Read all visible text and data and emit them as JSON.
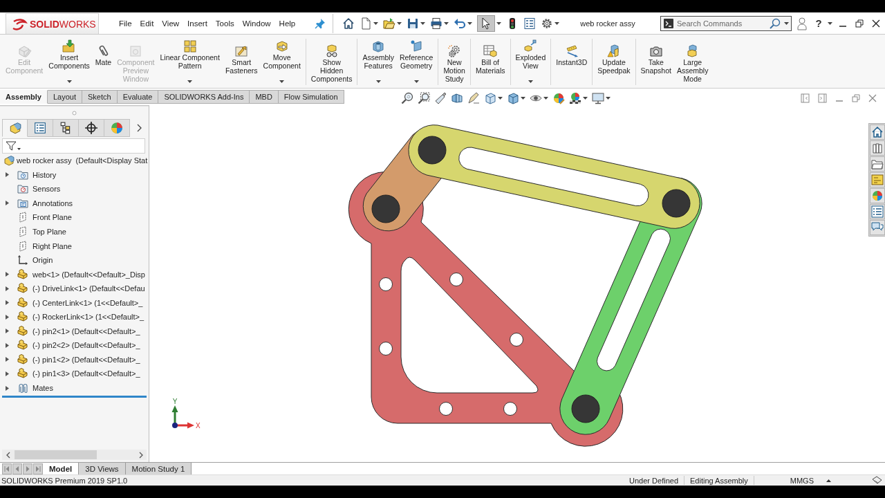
{
  "logo": {
    "text": "**SOLID**WORKS"
  },
  "menu": [
    "File",
    "Edit",
    "View",
    "Insert",
    "Tools",
    "Window",
    "Help"
  ],
  "document_title": "web rocker assy",
  "search": {
    "placeholder": "Search Commands"
  },
  "help": {
    "label": "?"
  },
  "ribbon": {
    "groups": [
      {
        "buttons": [
          {
            "label": "Edit\nComponent",
            "disabled": true,
            "dropdown": false
          },
          {
            "label": "Insert\nComponents",
            "disabled": false,
            "dropdown": true
          },
          {
            "label": "Mate",
            "disabled": false,
            "dropdown": false
          },
          {
            "label": "Component\nPreview\nWindow",
            "disabled": true,
            "dropdown": false
          },
          {
            "label": "Linear Component\nPattern",
            "disabled": false,
            "dropdown": true
          },
          {
            "label": "Smart\nFasteners",
            "disabled": false,
            "dropdown": false
          },
          {
            "label": "Move\nComponent",
            "disabled": false,
            "dropdown": true
          }
        ]
      },
      {
        "buttons": [
          {
            "label": "Show\nHidden\nComponents",
            "disabled": false,
            "dropdown": false
          }
        ]
      },
      {
        "buttons": [
          {
            "label": "Assembly\nFeatures",
            "disabled": false,
            "dropdown": true
          },
          {
            "label": "Reference\nGeometry",
            "disabled": false,
            "dropdown": true
          }
        ]
      },
      {
        "buttons": [
          {
            "label": "New\nMotion\nStudy",
            "disabled": false,
            "dropdown": false
          }
        ]
      },
      {
        "buttons": [
          {
            "label": "Bill of\nMaterials",
            "disabled": false,
            "dropdown": false
          }
        ]
      },
      {
        "buttons": [
          {
            "label": "Exploded\nView",
            "disabled": false,
            "dropdown": true
          }
        ]
      },
      {
        "buttons": [
          {
            "label": "Instant3D",
            "disabled": false,
            "dropdown": false
          }
        ]
      },
      {
        "buttons": [
          {
            "label": "Update\nSpeedpak",
            "disabled": false,
            "dropdown": false
          }
        ]
      },
      {
        "buttons": [
          {
            "label": "Take\nSnapshot",
            "disabled": false,
            "dropdown": false
          },
          {
            "label": "Large\nAssembly\nMode",
            "disabled": false,
            "dropdown": false
          }
        ]
      }
    ]
  },
  "command_tabs": [
    {
      "label": "Assembly",
      "selected": true
    },
    {
      "label": "Layout",
      "selected": false
    },
    {
      "label": "Sketch",
      "selected": false
    },
    {
      "label": "Evaluate",
      "selected": false
    },
    {
      "label": "SOLIDWORKS Add-Ins",
      "selected": false
    },
    {
      "label": "MBD",
      "selected": false
    },
    {
      "label": "Flow Simulation",
      "selected": false
    }
  ],
  "feature_manager": {
    "panel_tabs": [
      {
        "selected": true
      },
      {
        "selected": false
      },
      {
        "selected": false
      },
      {
        "selected": false
      },
      {
        "selected": false
      }
    ],
    "tree": {
      "label": "web rocker assy  (Default<Display Stat",
      "children": [
        {
          "label": "History",
          "kind": "history",
          "expandable": true
        },
        {
          "label": "Sensors",
          "kind": "sensors",
          "expandable": false
        },
        {
          "label": "Annotations",
          "kind": "annotations",
          "expandable": true
        },
        {
          "label": "Front Plane",
          "kind": "plane",
          "expandable": false
        },
        {
          "label": "Top Plane",
          "kind": "plane",
          "expandable": false
        },
        {
          "label": "Right Plane",
          "kind": "plane",
          "expandable": false
        },
        {
          "label": "Origin",
          "kind": "origin",
          "expandable": false
        },
        {
          "label": "web<1> (Default<<Default>_Disp",
          "kind": "part",
          "expandable": true
        },
        {
          "label": "(-) DriveLink<1> (Default<<Defau",
          "kind": "part",
          "expandable": true
        },
        {
          "label": "(-) CenterLink<1> (1<<Default>_",
          "kind": "part",
          "expandable": true
        },
        {
          "label": "(-) RockerLink<1> (1<<Default>_",
          "kind": "part",
          "expandable": true
        },
        {
          "label": "(-) pin2<1> (Default<<Default>_",
          "kind": "part",
          "expandable": true
        },
        {
          "label": "(-) pin2<2> (Default<<Default>_",
          "kind": "part",
          "expandable": true
        },
        {
          "label": "(-) pin1<2> (Default<<Default>_",
          "kind": "part",
          "expandable": true
        },
        {
          "label": "(-) pin1<3> (Default<<Default>_",
          "kind": "part",
          "expandable": true
        },
        {
          "label": "Mates",
          "kind": "mates",
          "expandable": true
        }
      ]
    }
  },
  "viewport": {
    "triad": {
      "x_label": "X",
      "y_label": "Y"
    }
  },
  "bottom_tabs": [
    {
      "label": "Model",
      "selected": true
    },
    {
      "label": "3D Views",
      "selected": false
    },
    {
      "label": "Motion Study 1",
      "selected": false
    }
  ],
  "status_bar": {
    "product": "SOLIDWORKS Premium 2019 SP1.0",
    "fields": [
      "Under Defined",
      "Editing Assembly",
      "MMGS"
    ]
  }
}
